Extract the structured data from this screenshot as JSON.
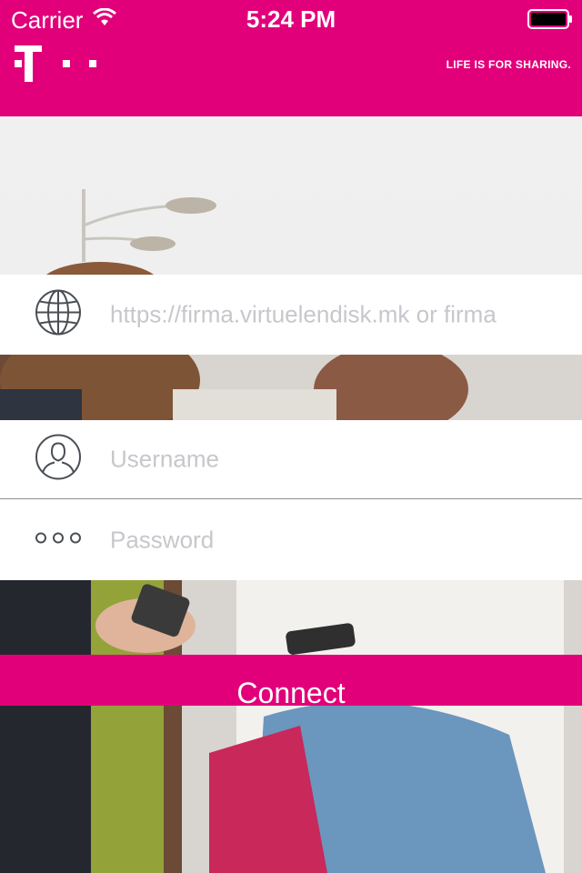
{
  "status_bar": {
    "carrier": "Carrier",
    "time": "5:24 PM",
    "icons": [
      "wifi-icon",
      "battery-icon"
    ]
  },
  "header": {
    "logo": "T · ·",
    "tagline": "LIFE IS FOR SHARING.",
    "background_color": "#e2007a"
  },
  "form": {
    "server": {
      "icon": "globe-icon",
      "placeholder": "https://firma.virtuelendisk.mk or firma"
    },
    "username": {
      "icon": "user-icon",
      "placeholder": "Username"
    },
    "password": {
      "icon": "dots-icon",
      "placeholder": "Password"
    }
  },
  "connect_button": {
    "label": "Connect",
    "color": "#e2007a"
  }
}
